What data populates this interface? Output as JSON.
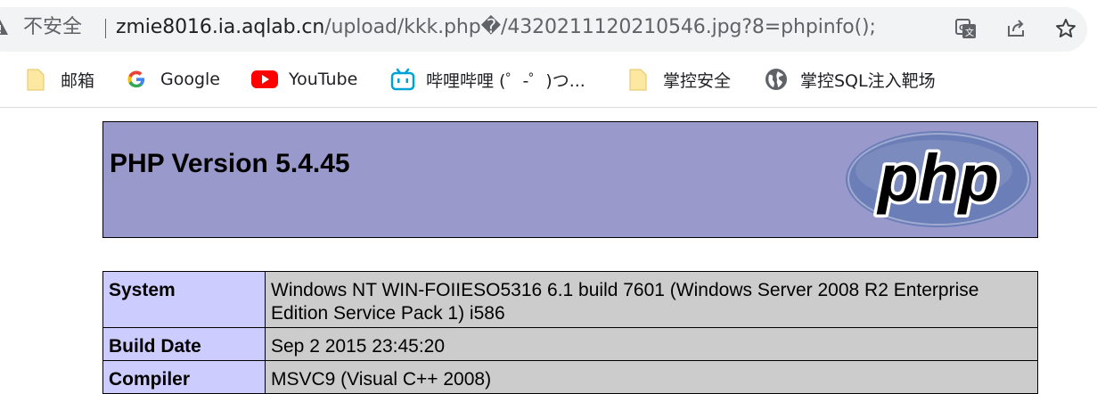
{
  "address_bar": {
    "security_label": "不安全",
    "url_host": "zmie8016.ia.aqlab.cn",
    "url_path": "/upload/kkk.php�/4320211120210546.jpg?8=phpinfo();"
  },
  "toolbar_icons": [
    "translate-icon",
    "share-icon",
    "bookmark-star-icon"
  ],
  "bookmarks": [
    {
      "label": "邮箱",
      "icon": "folder-icon"
    },
    {
      "label": "Google",
      "icon": "google-icon"
    },
    {
      "label": "YouTube",
      "icon": "youtube-icon"
    },
    {
      "label": "哔哩哔哩 (゜-゜)つ...",
      "icon": "bilibili-icon"
    },
    {
      "label": "掌控安全",
      "icon": "folder-icon"
    },
    {
      "label": "掌控SQL注入靶场",
      "icon": "globe-icon"
    }
  ],
  "phpinfo": {
    "title": "PHP Version 5.4.45",
    "logo_text": "php",
    "rows": [
      {
        "key": "System",
        "value": "Windows NT WIN-FOIIESO5316 6.1 build 7601 (Windows Server 2008 R2 Enterprise Edition Service Pack 1) i586"
      },
      {
        "key": "Build Date",
        "value": "Sep 2 2015 23:45:20"
      },
      {
        "key": "Compiler",
        "value": "MSVC9 (Visual C++ 2008)"
      }
    ]
  },
  "colors": {
    "header_bg": "#9999cc",
    "key_bg": "#ccccff",
    "value_bg": "#cccccc",
    "youtube_red": "#ff0000",
    "bilibili_blue": "#00a1d6",
    "folder_yellow": "#fce8a0"
  }
}
